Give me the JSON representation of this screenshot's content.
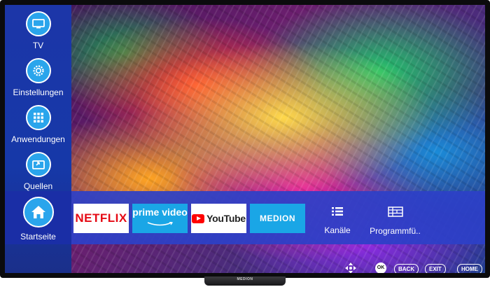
{
  "sidebar": {
    "items": [
      {
        "label": "TV",
        "icon": "tv-icon"
      },
      {
        "label": "Einstellungen",
        "icon": "gear-icon"
      },
      {
        "label": "Anwendungen",
        "icon": "apps-grid-icon"
      },
      {
        "label": "Quellen",
        "icon": "input-source-icon"
      }
    ]
  },
  "home": {
    "label": "Startseite",
    "icon": "home-icon"
  },
  "apps": [
    {
      "label": "NETFLIX"
    },
    {
      "label": "prime video"
    },
    {
      "label": "YouTube"
    },
    {
      "label": "MEDION"
    }
  ],
  "functions": [
    {
      "label": "Kanäle",
      "icon": "channel-list-icon"
    },
    {
      "label": "Programmfü..",
      "icon": "program-guide-icon"
    }
  ],
  "hints": {
    "ok": "OK",
    "back": "BACK",
    "exit": "EXIT",
    "home": "HOME"
  },
  "brand": {
    "stand_logo": "MEDION"
  },
  "colors": {
    "sidebar": "#1c36a8",
    "accent": "#2aa5ec",
    "netflix_red": "#e50914",
    "prime_blue": "#1aa6e6"
  }
}
